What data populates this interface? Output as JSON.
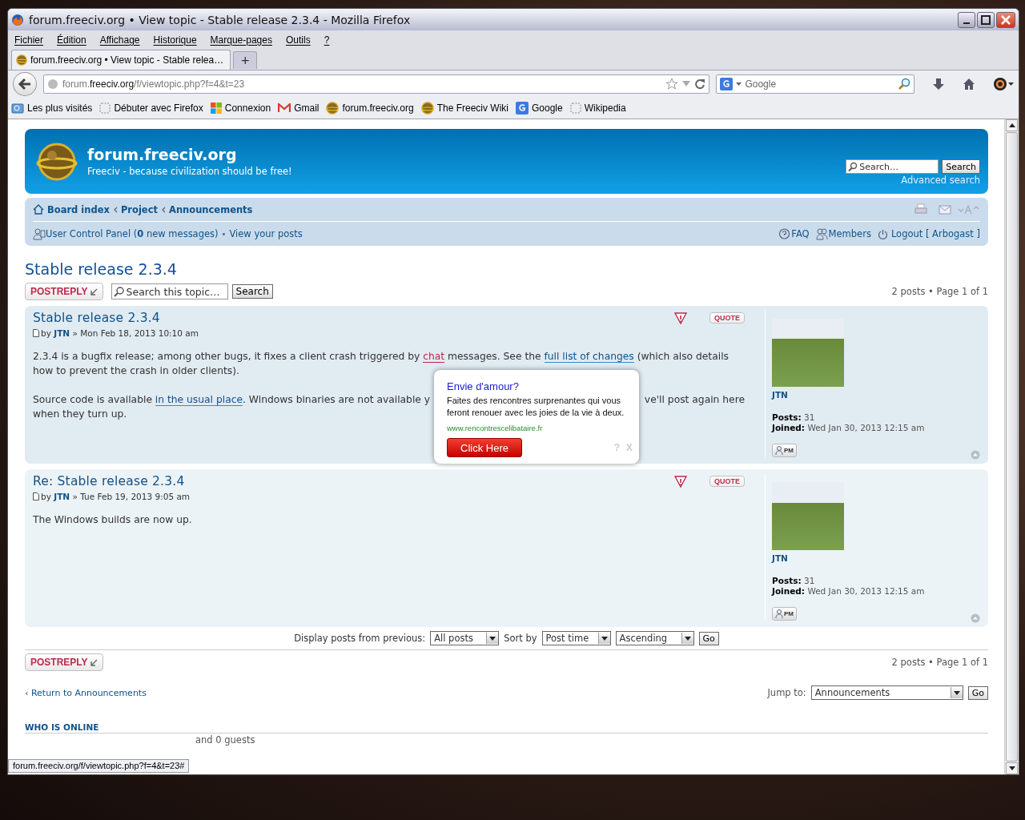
{
  "window": {
    "title": "forum.freeciv.org • View topic - Stable release 2.3.4 - Mozilla Firefox"
  },
  "menu": [
    "Fichier",
    "Édition",
    "Affichage",
    "Historique",
    "Marque-pages",
    "Outils",
    "?"
  ],
  "tabs": [
    {
      "label": "forum.freeciv.org • View topic - Stable relea…",
      "selected": true
    }
  ],
  "new_tab": "+",
  "address": {
    "prefix": "forum.",
    "domain": "freeciv.org",
    "path": "/f/viewtopic.php?f=4&t=23"
  },
  "web_search": {
    "placeholder": "Google"
  },
  "bookmarks": [
    {
      "label": "Les plus visités",
      "kind": "folder"
    },
    {
      "label": "Débuter avec Firefox",
      "kind": "blank"
    },
    {
      "label": "Connexion",
      "kind": "windows"
    },
    {
      "label": "Gmail",
      "kind": "mail"
    },
    {
      "label": "forum.freeciv.org",
      "kind": "globe"
    },
    {
      "label": "The Freeciv Wiki",
      "kind": "globe"
    },
    {
      "label": "Google",
      "kind": "google"
    },
    {
      "label": "Wikipedia",
      "kind": "blank"
    }
  ],
  "site": {
    "title": "forum.freeciv.org",
    "tagline": "Freeciv - because civilization should be free!",
    "search_placeholder": "Search…",
    "search_button": "Search",
    "advanced": "Advanced search"
  },
  "breadcrumbs": [
    "Board index",
    "Project",
    "Announcements"
  ],
  "user_links": {
    "ucp": "User Control Panel (",
    "count": "0",
    "ucp_tail": "new messages)",
    "sep": "•",
    "own_posts": "View your posts",
    "faq": "FAQ",
    "members": "Members",
    "logout": "Logout [ Arbogast ]"
  },
  "topic": {
    "title": "Stable release 2.3.4",
    "reply": "POSTREPLY",
    "search_placeholder": "Search this topic…",
    "search_button": "Search",
    "pagination": "2 posts • Page 1 of 1"
  },
  "posts": [
    {
      "title": "Stable release 2.3.4",
      "by": "by",
      "author": "JTN",
      "date": "» Mon Feb 18, 2013 10:10 am",
      "quote": "QUOTE",
      "paragraphs": [
        {
          "parts": [
            [
              {
                "kind": "text",
                "text": "2.3.4 is a bugfix release; among other bugs, it fixes a client crash triggered by "
              },
              {
                "kind": "hot",
                "text": "chat"
              },
              {
                "kind": "text",
                "text": " messages. See the "
              },
              {
                "kind": "link",
                "text": "full list of changes"
              },
              {
                "kind": "text",
                "text": " (which also details how to prevent the crash in older clients)."
              }
            ]
          ]
        },
        {
          "parts": [
            [
              {
                "kind": "text",
                "text": "Source code is available "
              },
              {
                "kind": "link",
                "text": "in the usual place"
              },
              {
                "kind": "text",
                "text": ". Windows binaries are not available y"
              }
            ],
            [
              {
                "kind": "text",
                "text": "ve'll post again here"
              }
            ]
          ],
          "continuation": "when they turn up."
        }
      ],
      "profile": {
        "name": "JTN",
        "posts_label": "Posts:",
        "posts": "31",
        "joined_label": "Joined:",
        "joined": "Wed Jan 30, 2013 12:15 am",
        "pm": "PM"
      }
    },
    {
      "title": "Re: Stable release 2.3.4",
      "by": "by",
      "author": "JTN",
      "date": "» Tue Feb 19, 2013 9:05 am",
      "quote": "QUOTE",
      "paragraphs": [
        {
          "parts": [
            [
              {
                "kind": "text",
                "text": "The Windows builds are now up."
              }
            ]
          ]
        }
      ],
      "profile": {
        "name": "JTN",
        "posts_label": "Posts:",
        "posts": "31",
        "joined_label": "Joined:",
        "joined": "Wed Jan 30, 2013 12:15 am",
        "pm": "PM"
      }
    }
  ],
  "ad": {
    "title": "Envie d'amour?",
    "text": "Faites des rencontres surprenantes qui vous feront renouer avec les joies de la vie à deux.",
    "url": "www.rencontrescelibataire.fr",
    "button": "Click Here",
    "help": "?",
    "close": "X"
  },
  "display": {
    "label": "Display posts from previous:",
    "period": "All posts",
    "sort_label": "Sort by",
    "sort": "Post time",
    "order": "Ascending",
    "go": "Go"
  },
  "footer": {
    "reply": "POSTREPLY",
    "pagination": "2 posts • Page 1 of 1",
    "return_mark": "‹",
    "return": "Return to Announcements",
    "jump_label": "Jump to:",
    "jump": "Announcements",
    "go": "Go",
    "online": "WHO IS ONLINE",
    "guests": "and 0 guests"
  },
  "status": "forum.freeciv.org/f/viewtopic.php?f=4&t=23#"
}
